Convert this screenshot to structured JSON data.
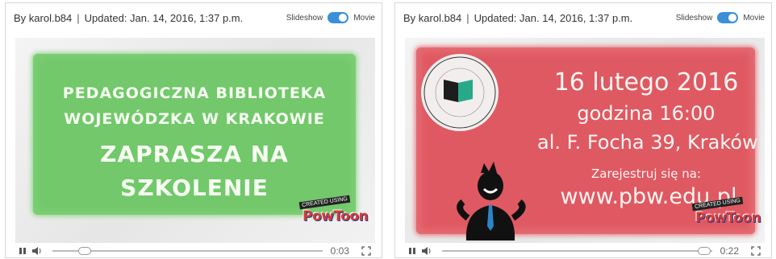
{
  "cards": [
    {
      "author": "By karol.b84",
      "separator": "|",
      "updated": "Updated: Jan. 14, 2016, 1:37 p.m.",
      "toggle_left": "Slideshow",
      "toggle_right": "Movie",
      "lines": [
        "PEDAGOGICZNA BIBLIOTEKA",
        "WOJEWÓDZKA W KRAKOWIE",
        "ZAPRASZA NA",
        "SZKOLENIE"
      ],
      "badge_top": "CREATED USING",
      "badge_logo": "PowToon",
      "time": "0:03",
      "progress": 0.12,
      "accent": "#72c86a"
    },
    {
      "author": "By karol.b84",
      "separator": "|",
      "updated": "Updated: Jan. 14, 2016, 1:37 p.m.",
      "toggle_left": "Slideshow",
      "toggle_right": "Movie",
      "lines": [
        "16 lutego 2016",
        "godzina 16:00",
        "al. F. Focha 39, Kraków",
        "Zarejestruj się na:",
        "www.pbw.edu.pl"
      ],
      "seal_text": "PEDAGOGICZNA BIBLIOTEKA WOJEWÓDZKA W KRAKOWIE",
      "badge_top": "CREATED USING",
      "badge_logo": "PowToon",
      "time": "0:22",
      "progress": 0.97,
      "accent": "#df5962"
    }
  ],
  "icons": {
    "play": "pause-icon",
    "volume": "volume-icon",
    "fullscreen": "fullscreen-icon"
  },
  "colors": {
    "toggle": "#3b8fd9"
  }
}
